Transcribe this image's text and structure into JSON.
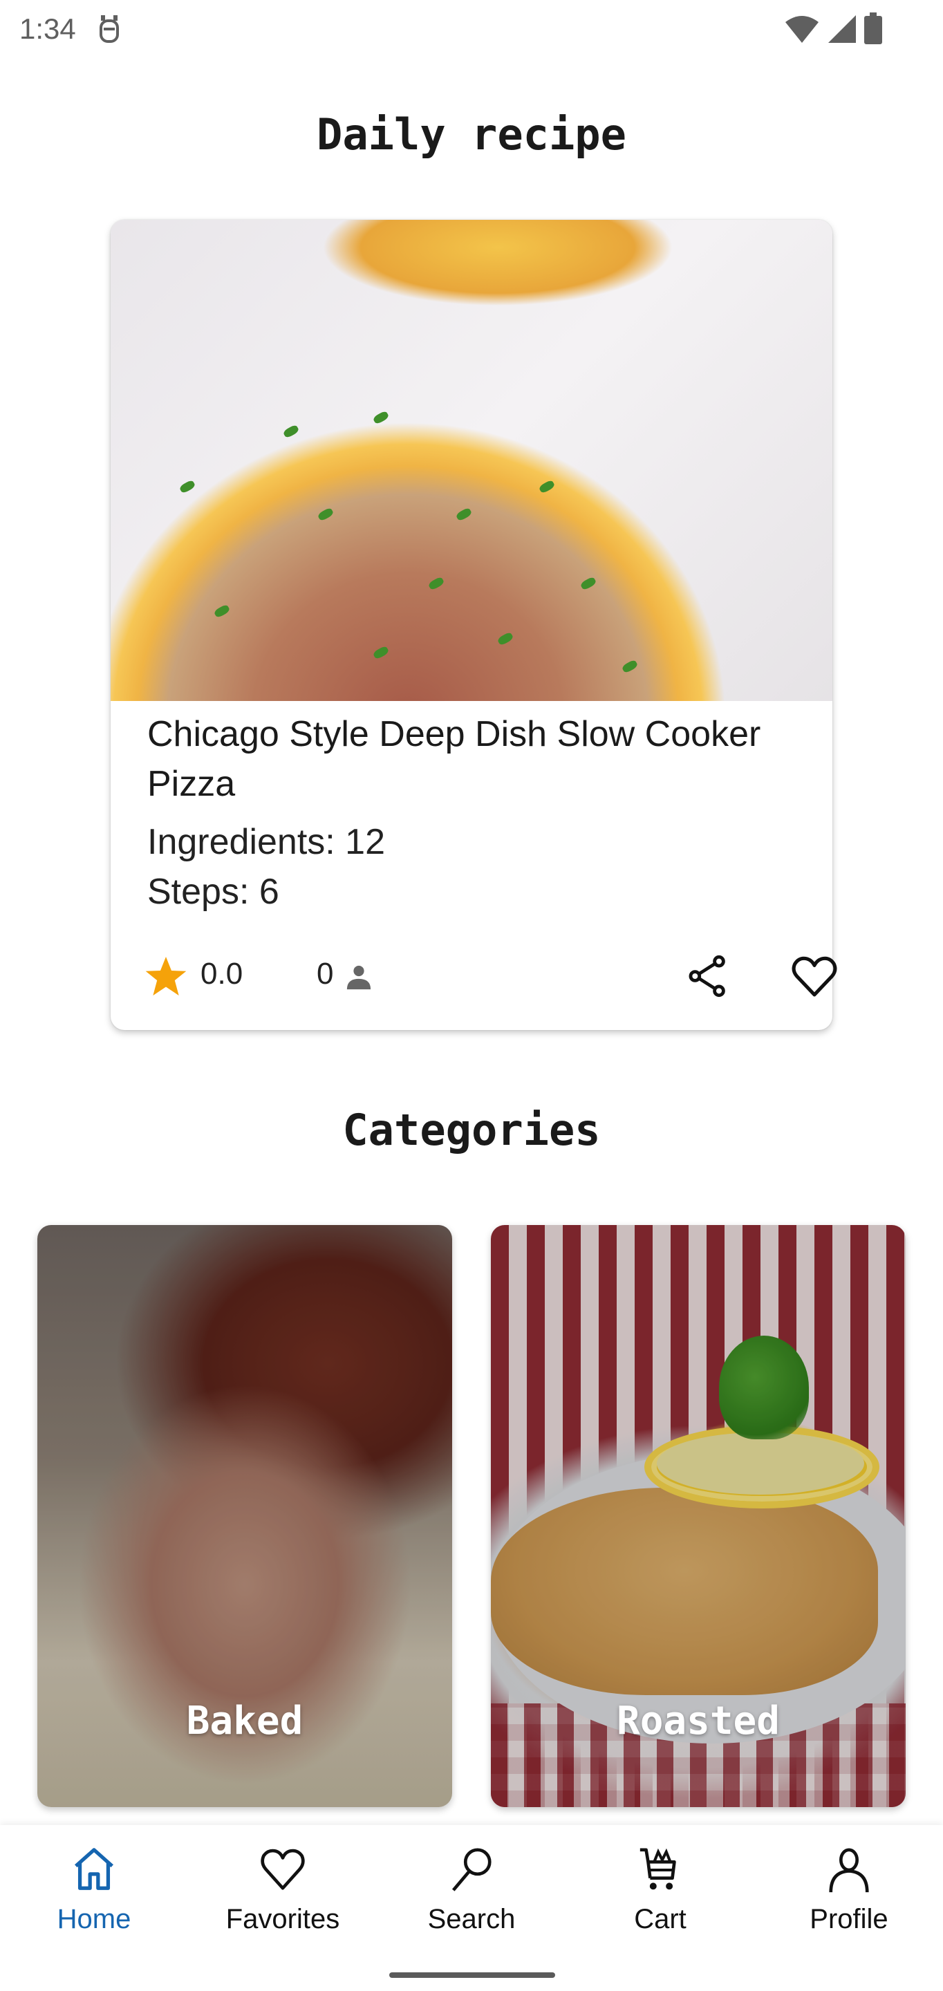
{
  "status_bar": {
    "time": "1:34",
    "icons": [
      "notification-icon",
      "wifi-icon",
      "signal-icon",
      "battery-icon"
    ]
  },
  "daily": {
    "title": "Daily recipe",
    "recipe": {
      "name": "Chicago Style Deep Dish Slow Cooker Pizza",
      "ingredients_label": "Ingredients: 12",
      "steps_label": "Steps: 6",
      "rating": "0.0",
      "reviews": "0",
      "image": "deep-dish-pizza-photo"
    },
    "actions": {
      "share": "share-icon",
      "favorite": "heart-icon"
    }
  },
  "categories": {
    "title": "Categories",
    "items": [
      {
        "label": "Baked",
        "image": "baked-meat-photo"
      },
      {
        "label": "Roasted",
        "image": "schnitzel-lemon-photo"
      }
    ]
  },
  "bottom_nav": {
    "active": "Home",
    "accent_color": "#1565b0",
    "items": [
      {
        "label": "Home",
        "icon": "home-icon"
      },
      {
        "label": "Favorites",
        "icon": "heart-icon"
      },
      {
        "label": "Search",
        "icon": "search-icon"
      },
      {
        "label": "Cart",
        "icon": "cart-icon"
      },
      {
        "label": "Profile",
        "icon": "person-icon"
      }
    ]
  },
  "colors": {
    "star": "#f5a20a",
    "nav_active": "#1565b0",
    "text": "#1a1a1a"
  }
}
